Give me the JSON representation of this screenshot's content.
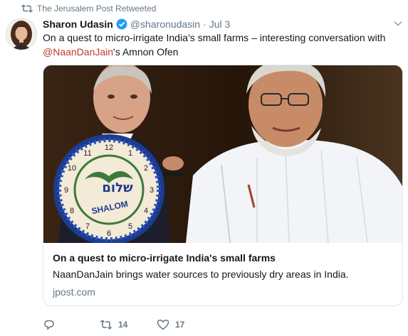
{
  "retweet_context": {
    "text": "The Jerusalem Post Retweeted"
  },
  "author": {
    "name": "Sharon Udasin",
    "handle": "@sharonudasin",
    "separator": "·",
    "date": "Jul 3",
    "verified": true
  },
  "tweet": {
    "text_before_mention": "On a quest to micro-irrigate India’s small farms – interesting conversation with ",
    "mention": "@NaanDanJain",
    "text_after_mention": "'s Amnon Ofen"
  },
  "card": {
    "title": "On a quest to micro-irrigate India's small farms",
    "description": "NaanDanJain brings water sources to previously dry areas in India.",
    "domain": "jpost.com",
    "image": {
      "plate_text": "SHALOM",
      "plate_hebrew": "שלום",
      "clock_numerals": [
        "12",
        "1",
        "2",
        "3",
        "4",
        "5",
        "6",
        "7",
        "8",
        "9",
        "10",
        "11"
      ]
    }
  },
  "actions": {
    "reply": {
      "icon": "reply-icon",
      "count": ""
    },
    "retweet": {
      "icon": "retweet-icon",
      "count": "14"
    },
    "like": {
      "icon": "heart-icon",
      "count": "17"
    }
  },
  "colors": {
    "text": "#14171a",
    "secondary": "#657786",
    "mention": "#c0392b",
    "verified": "#1da1f2",
    "border": "#e1e8ed"
  }
}
